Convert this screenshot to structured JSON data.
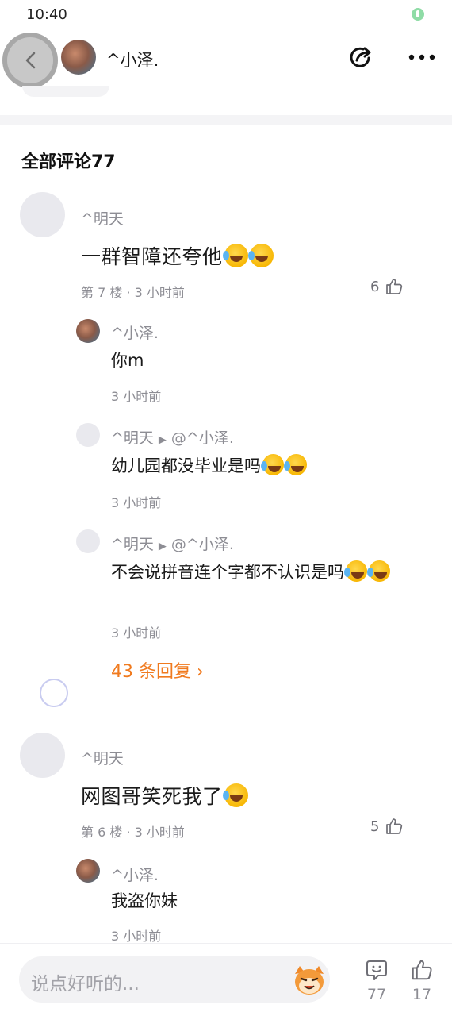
{
  "status_bar": {
    "time": "10:40"
  },
  "header": {
    "name": "^小泽."
  },
  "section": {
    "title": "全部评论77"
  },
  "comments": [
    {
      "user": "^明天",
      "text": "一群智障还夸他",
      "meta": "第 7 楼 · 3 小时前",
      "likes": "6",
      "replies": [
        {
          "user": "^小泽.",
          "text": "你m",
          "time": "3 小时前"
        },
        {
          "user": "^明天",
          "target": "@^小泽.",
          "text": "幼儿园都没毕业是吗",
          "time": "3 小时前"
        },
        {
          "user": "^明天",
          "target": "@^小泽.",
          "text": "不会说拼音连个字都不认识是吗",
          "time": "3 小时前"
        }
      ],
      "more_replies": "43 条回复"
    },
    {
      "user": "^明天",
      "text": "网图哥笑死我了",
      "meta": "第 6 楼 · 3 小时前",
      "likes": "5",
      "replies": [
        {
          "user": "^小泽.",
          "text": "我盗你妹",
          "time": "3 小时前"
        }
      ]
    }
  ],
  "bottom_bar": {
    "input_placeholder": "说点好听的...",
    "comment_count": "77",
    "like_count": "17"
  },
  "colors": {
    "accent_orange": "#f07a1e",
    "secondary_text": "#8d8d94",
    "emoji_yellow": "#f7b500"
  },
  "icons": [
    "back-icon",
    "share-icon",
    "more-icon",
    "thumbs-up-icon",
    "comment-bubble-icon",
    "mascot-icon",
    "laughing-emoji-icon",
    "chevron-right-icon"
  ]
}
